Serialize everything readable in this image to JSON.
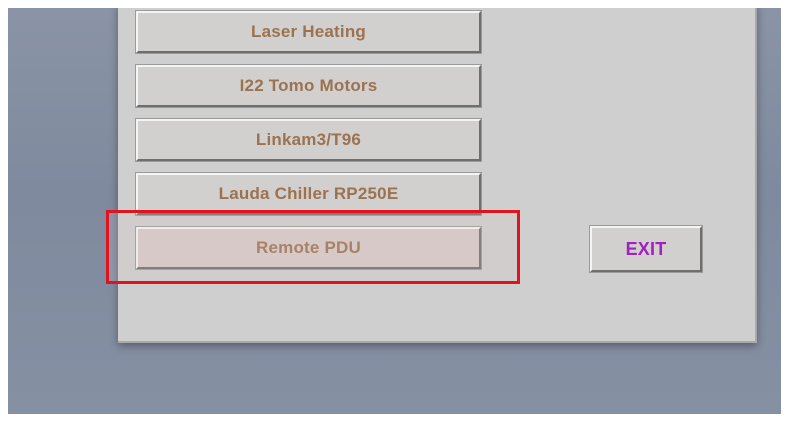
{
  "menu": {
    "buttons": [
      {
        "label": "Laser Heating"
      },
      {
        "label": "I22 Tomo Motors"
      },
      {
        "label": "Linkam3/T96"
      },
      {
        "label": "Lauda Chiller RP250E"
      },
      {
        "label": "Remote PDU"
      }
    ]
  },
  "exit": {
    "label": "EXIT"
  },
  "colors": {
    "desktop": "#8690a3",
    "panel": "#cfcfcf",
    "button_text": "#9b7350",
    "exit_text": "#a020c0",
    "highlight": "#e0141e"
  }
}
